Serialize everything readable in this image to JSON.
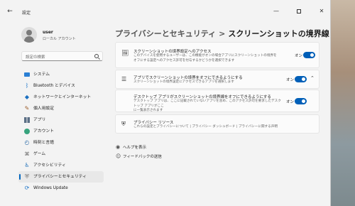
{
  "window": {
    "app_title": "設定",
    "back_icon": "back-arrow-icon"
  },
  "user": {
    "name": "user",
    "account_type": "ローカル アカウント"
  },
  "search": {
    "placeholder": "設定の検索"
  },
  "nav": {
    "items": [
      {
        "label": "システム",
        "icon": "system-icon"
      },
      {
        "label": "Bluetooth とデバイス",
        "icon": "bluetooth-icon"
      },
      {
        "label": "ネットワークとインターネット",
        "icon": "network-icon"
      },
      {
        "label": "個人用設定",
        "icon": "personalization-icon"
      },
      {
        "label": "アプリ",
        "icon": "apps-icon"
      },
      {
        "label": "アカウント",
        "icon": "accounts-icon"
      },
      {
        "label": "時刻と言語",
        "icon": "time-language-icon"
      },
      {
        "label": "ゲーム",
        "icon": "gaming-icon"
      },
      {
        "label": "アクセシビリティ",
        "icon": "accessibility-icon"
      },
      {
        "label": "プライバシーとセキュリティ",
        "icon": "privacy-icon",
        "active": true
      },
      {
        "label": "Windows Update",
        "icon": "windows-update-icon"
      }
    ]
  },
  "breadcrumb": {
    "parent": "プライバシーとセキュリティ",
    "separator": ">",
    "current": "スクリーンショットの境界線"
  },
  "settings": {
    "access": {
      "title": "スクリーンショットの境界設定へのアクセス",
      "desc_line1": "このデバイスを使用するユーザーは、この機能がオンの場合アプリにスクリーンショットの境界を",
      "desc_line2": "オフにする設定へのアクセス許可を付与するかどうかを選択できます",
      "toggle_label": "オン"
    },
    "apps": {
      "title": "アプリでスクリーンショットの境界をオフにできるようにする",
      "desc": "スクリーンショットの境界設定にアクセスできるアプリを選択します",
      "toggle_label": "オン"
    },
    "desktop_apps": {
      "title": "デスクトップ アプリがスクリーンショットの境界線をオフにできるようにする",
      "desc_line1": "デスクトップ アプリは、ここに記載されていないアプリを含め、このアクセス許可を要求したデスクトップ アプリがここ",
      "desc_line2": "に一覧表示されます",
      "toggle_label": "オン"
    },
    "privacy": {
      "title": "プライバシー リソース",
      "links": "これらの設定とプライバシーについて | プライバシー ダッシュボード | プライバシーに関する声明"
    }
  },
  "footer_links": {
    "help": "ヘルプを表示",
    "feedback": "フィードバックの送信"
  },
  "colors": {
    "accent": "#005fb8",
    "window_bg": "#f3f3f3",
    "card_bg": "#fbfbfb"
  }
}
